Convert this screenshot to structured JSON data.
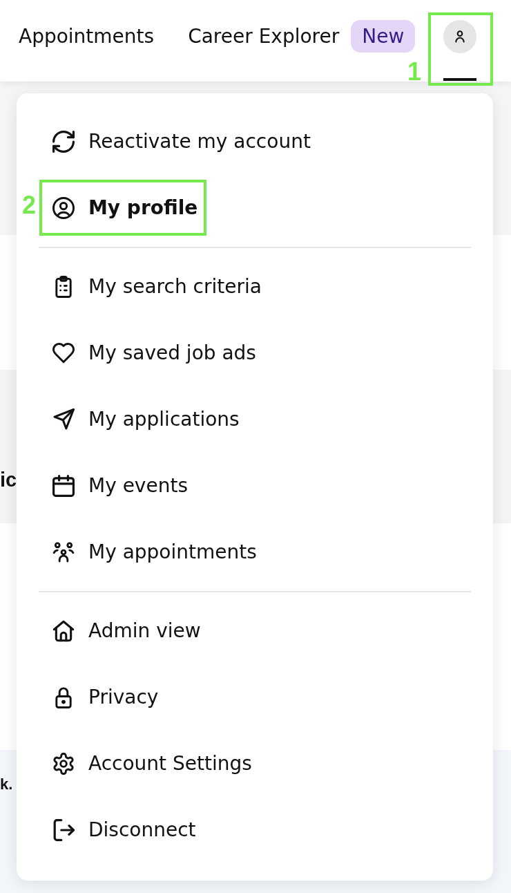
{
  "nav": {
    "links": [
      {
        "label": "Appointments"
      },
      {
        "label": "Career Explorer",
        "badge": "New"
      }
    ],
    "profile_button": {
      "selected": true,
      "callout": "1"
    }
  },
  "menu": {
    "sections": [
      {
        "items": [
          {
            "label": "Reactivate my account",
            "selected": false
          },
          {
            "label": "My profile",
            "selected": true,
            "callout": "2"
          }
        ]
      },
      {
        "items": [
          {
            "label": "My search criteria",
            "selected": false
          },
          {
            "label": "My saved job ads",
            "selected": false
          },
          {
            "label": "My applications",
            "selected": false
          },
          {
            "label": "My events",
            "selected": false
          },
          {
            "label": "My appointments",
            "selected": false
          }
        ]
      },
      {
        "items": [
          {
            "label": "Admin view",
            "selected": false
          },
          {
            "label": "Privacy",
            "selected": false
          },
          {
            "label": "Account Settings",
            "selected": false
          },
          {
            "label": "Disconnect",
            "selected": false
          }
        ]
      }
    ]
  },
  "page_behind": {
    "fragments": [
      "ic",
      "k."
    ]
  }
}
